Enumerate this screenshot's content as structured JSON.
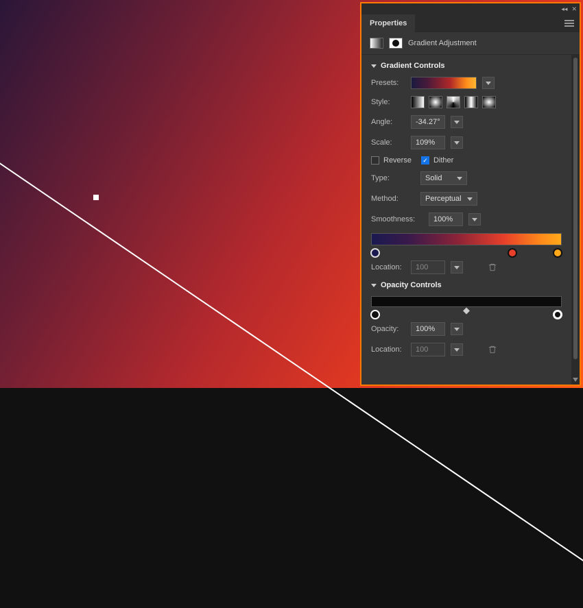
{
  "panel": {
    "tab_label": "Properties",
    "header_label": "Gradient Adjustment"
  },
  "gradient_controls": {
    "title": "Gradient Controls",
    "presets_label": "Presets:",
    "style_label": "Style:",
    "angle_label": "Angle:",
    "angle_value": "-34.27°",
    "scale_label": "Scale:",
    "scale_value": "109%",
    "reverse_label": "Reverse",
    "reverse_checked": false,
    "dither_label": "Dither",
    "dither_checked": true,
    "type_label": "Type:",
    "type_value": "Solid",
    "method_label": "Method:",
    "method_value": "Perceptual",
    "smoothness_label": "Smoothness:",
    "smoothness_value": "100%",
    "color_stops": [
      {
        "position": 0,
        "color": "#1a1a50"
      },
      {
        "position": 72,
        "color": "#e8402a"
      },
      {
        "position": 100,
        "color": "#ffa91a"
      }
    ],
    "location_label": "Location:",
    "location_value": "100"
  },
  "opacity_controls": {
    "title": "Opacity Controls",
    "opacity_stops": [
      {
        "position": 0
      },
      {
        "position": 100
      }
    ],
    "midpoint": 50,
    "opacity_label": "Opacity:",
    "opacity_value": "100%",
    "location_label": "Location:",
    "location_value": "100"
  }
}
